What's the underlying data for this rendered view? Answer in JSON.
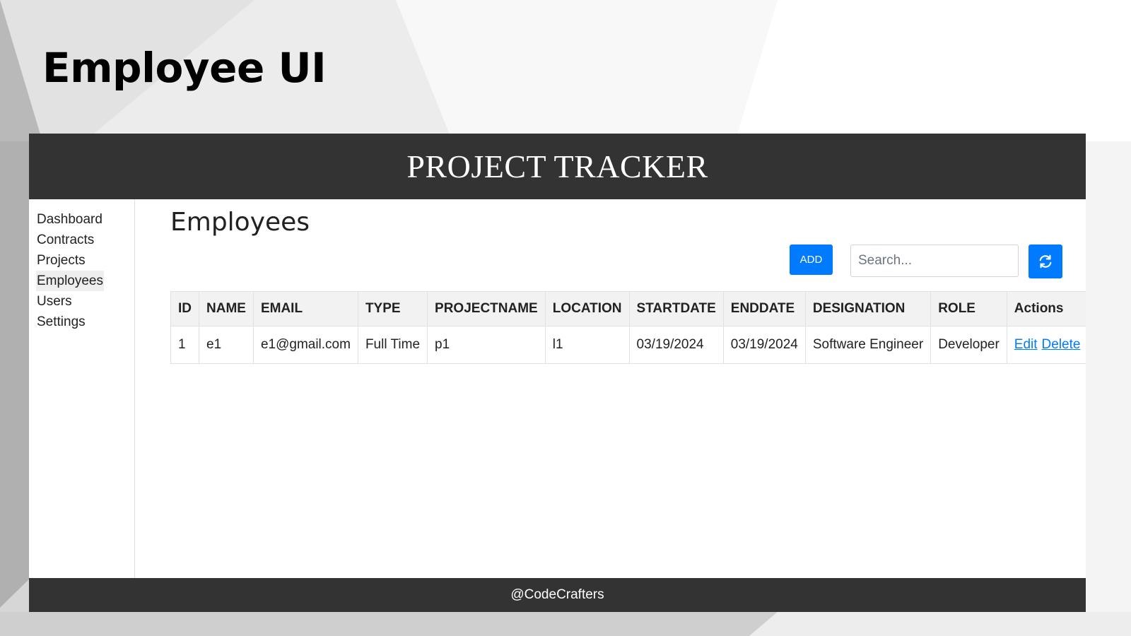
{
  "slide": {
    "title": "Employee UI"
  },
  "header": {
    "title": "PROJECT TRACKER"
  },
  "sidebar": {
    "items": [
      {
        "label": "Dashboard"
      },
      {
        "label": "Contracts"
      },
      {
        "label": "Projects"
      },
      {
        "label": "Employees",
        "active": true
      },
      {
        "label": "Users"
      },
      {
        "label": "Settings"
      }
    ]
  },
  "main": {
    "title": "Employees",
    "add_label": "ADD",
    "search_placeholder": "Search...",
    "refresh_icon": "refresh-icon"
  },
  "table": {
    "columns": [
      "ID",
      "NAME",
      "EMAIL",
      "TYPE",
      "PROJECTNAME",
      "LOCATION",
      "STARTDATE",
      "ENDDATE",
      "DESIGNATION",
      "ROLE",
      "Actions"
    ],
    "rows": [
      {
        "id": "1",
        "name": "e1",
        "email": "e1@gmail.com",
        "type": "Full Time",
        "projectname": "p1",
        "location": "l1",
        "startdate": "03/19/2024",
        "enddate": "03/19/2024",
        "designation": "Software Engineer",
        "role": "Developer",
        "edit_label": "Edit",
        "delete_label": "Delete"
      }
    ]
  },
  "footer": {
    "text": "@CodeCrafters"
  },
  "colors": {
    "header_bg": "#333333",
    "primary": "#007bff",
    "link": "#007bff"
  }
}
